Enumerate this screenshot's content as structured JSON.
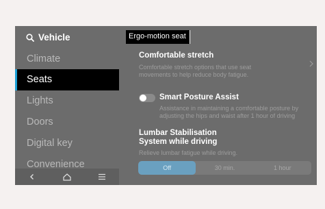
{
  "sidebar": {
    "title": "Vehicle",
    "items": [
      {
        "label": "Climate"
      },
      {
        "label": "Seats"
      },
      {
        "label": "Lights"
      },
      {
        "label": "Doors"
      },
      {
        "label": "Digital key"
      },
      {
        "label": "Convenience"
      }
    ],
    "active_index": 1,
    "bottom_icons": [
      "back-icon",
      "home-icon",
      "menu-icon"
    ]
  },
  "tooltip": {
    "text": "Ergo-motion seat"
  },
  "settings": {
    "comfortable_stretch": {
      "title": "Comfortable stretch",
      "description_line1": "Comfortable stretch options that use seat",
      "description_line2": "movements to help reduce body fatigue."
    },
    "smart_posture": {
      "title": "Smart Posture Assist",
      "description_line1": "Assistance in maintaining a comfortable posture by",
      "description_line2": "adjusting the hips and waist after 1 hour of driving",
      "enabled": false
    },
    "lumbar": {
      "title_line1": "Lumbar Stabilisation",
      "title_line2": "System while driving",
      "description": "Relieve lumbar fatigue while driving.",
      "options": [
        "Off",
        "30 min.",
        "1 hour"
      ],
      "selected_index": 0
    }
  },
  "colors": {
    "accent": "#1aa0d6",
    "selected_segment": "#6aa0c0",
    "screen_background": "#6c6c6c"
  }
}
